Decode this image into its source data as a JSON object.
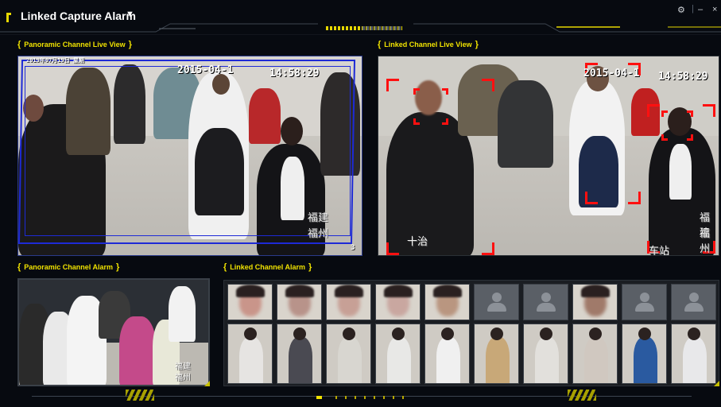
{
  "app": {
    "title": "Linked Capture Alarm",
    "title_menu_icon": "caret-down-icon",
    "settings_icon": "gear-icon",
    "window_separator": "|",
    "minimize_label": "–",
    "close_label": "×"
  },
  "panoramic_live": {
    "heading": "Panoramic Channel Live View",
    "osd_date": "2015-04-1",
    "osd_time": "14:58:29",
    "osd_top_left": "2019年07月19日 星期",
    "sign_text_1": "福建",
    "sign_text_2": "福州",
    "osd_corner_digit": "3"
  },
  "linked_live": {
    "heading": "Linked Channel Live View",
    "osd_date": "2015-04-1",
    "osd_time": "14:58:29",
    "sign_text_1": "福建",
    "sign_text_2": "福州",
    "bottom_text_left": "十治",
    "bottom_text_right": "车站",
    "detection_color": "#ff1010"
  },
  "panoramic_alarm": {
    "heading": "Panoramic Channel Alarm",
    "sign_text_1": "福建",
    "sign_text_2": "福州"
  },
  "linked_alarm": {
    "heading": "Linked Channel Alarm",
    "captures": [
      {
        "face": "captured",
        "face_tone": "#c9958a"
      },
      {
        "face": "captured",
        "face_tone": "#b8938a"
      },
      {
        "face": "captured",
        "face_tone": "#c7a096"
      },
      {
        "face": "captured",
        "face_tone": "#c9a7a0"
      },
      {
        "face": "captured",
        "face_tone": "#b99680"
      },
      {
        "face": "placeholder",
        "face_icon": "person-placeholder-icon"
      },
      {
        "face": "placeholder",
        "face_icon": "person-placeholder-icon"
      },
      {
        "face": "captured",
        "face_tone": "#a07a6a"
      },
      {
        "face": "placeholder",
        "face_icon": "person-placeholder-icon"
      },
      {
        "face": "placeholder",
        "face_icon": "person-placeholder-icon"
      }
    ]
  },
  "theme": {
    "accent": "#f0e200",
    "roi_border": "#1e2ad6",
    "background": "#070a10"
  },
  "pagination": {
    "pages": 9,
    "active_page": 1
  }
}
